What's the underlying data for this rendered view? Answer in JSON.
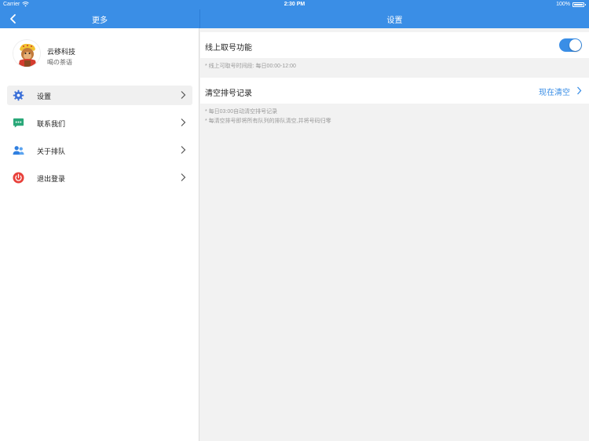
{
  "status_bar": {
    "carrier": "Carrier",
    "time": "2:30 PM",
    "battery": "100%"
  },
  "left_nav": {
    "title": "更多"
  },
  "right_nav": {
    "title": "设置"
  },
  "profile": {
    "name": "云移科技",
    "subtitle": "喝の茶语"
  },
  "menu": {
    "items": [
      {
        "label": "设置",
        "icon": "gear-icon"
      },
      {
        "label": "联系我们",
        "icon": "chat-bubble-icon"
      },
      {
        "label": "关于排队",
        "icon": "users-icon"
      },
      {
        "label": "退出登录",
        "icon": "power-icon"
      }
    ]
  },
  "settings": {
    "online_queue": {
      "label": "线上取号功能",
      "enabled": true,
      "note": "* 线上可取号时间段: 每日00:00-12:00"
    },
    "clear_records": {
      "label": "清空排号记录",
      "action": "现在清空",
      "notes": [
        "* 每日03:00自动清空排号记录",
        "* 每清空排号即将所有队列的排队清空,并将号码归零"
      ]
    }
  },
  "colors": {
    "accent": "#3a8ee6",
    "background": "#f2f2f2",
    "logout_icon": "#e8403a",
    "chat_icon": "#2aa879"
  }
}
